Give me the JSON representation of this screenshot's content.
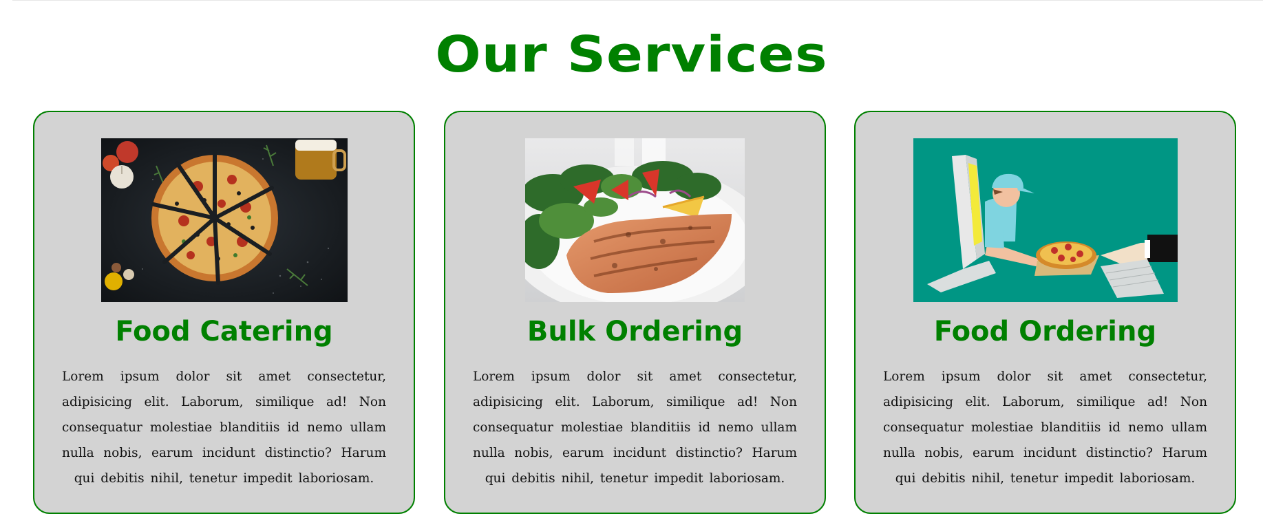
{
  "page": {
    "heading": "Our Services"
  },
  "services": [
    {
      "title": "Food Catering",
      "image": "pizza-photo",
      "text": "Lorem ipsum dolor sit amet consectetur, adipisicing elit. Laborum, similique ad! Non consequatur molestiae blanditiis id nemo ullam nulla nobis, earum incidunt distinctio? Harum qui debitis nihil, tenetur impedit laboriosam."
    },
    {
      "title": "Bulk Ordering",
      "image": "salmon-salad-photo",
      "text": "Lorem ipsum dolor sit amet consectetur, adipisicing elit. Laborum, similique ad! Non consequatur molestiae blanditiis id nemo ullam nulla nobis, earum incidunt distinctio? Harum qui debitis nihil, tenetur impedit laboriosam."
    },
    {
      "title": "Food Ordering",
      "image": "online-pizza-delivery-illustration",
      "text": "Lorem ipsum dolor sit amet consectetur, adipisicing elit. Laborum, similique ad! Non consequatur molestiae blanditiis id nemo ullam nulla nobis, earum incidunt distinctio? Harum qui debitis nihil, tenetur impedit laboriosam."
    }
  ],
  "colors": {
    "accent": "#008000",
    "card_background": "#d3d3d3",
    "page_background": "#ffffff",
    "illustration_teal": "#009684"
  }
}
